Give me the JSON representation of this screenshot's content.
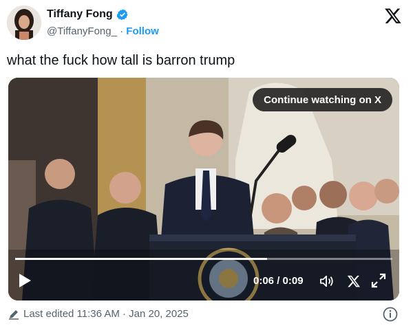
{
  "author": {
    "name": "Tiffany Fong",
    "handle": "@TiffanyFong_",
    "separator": "·",
    "follow_label": "Follow",
    "avatar_icon": "profile-photo",
    "verified_icon": "verified-badge-icon"
  },
  "tweet": {
    "text": "what the fuck how tall is barron trump"
  },
  "video": {
    "continue_label": "Continue watching on X",
    "time_display": "0:06 / 0:09",
    "progress_fraction": 0.667,
    "controls": [
      "play-icon",
      "volume-icon",
      "x-logo-icon",
      "expand-icon"
    ]
  },
  "footer": {
    "edited_text": "Last edited 11:36 AM · Jan 20, 2025",
    "pencil_icon": "pencil-icon",
    "info_icon": "info-icon"
  },
  "colors": {
    "link": "#1d9bf0",
    "secondary_text": "#536471",
    "verified": "#1d9bf0"
  }
}
